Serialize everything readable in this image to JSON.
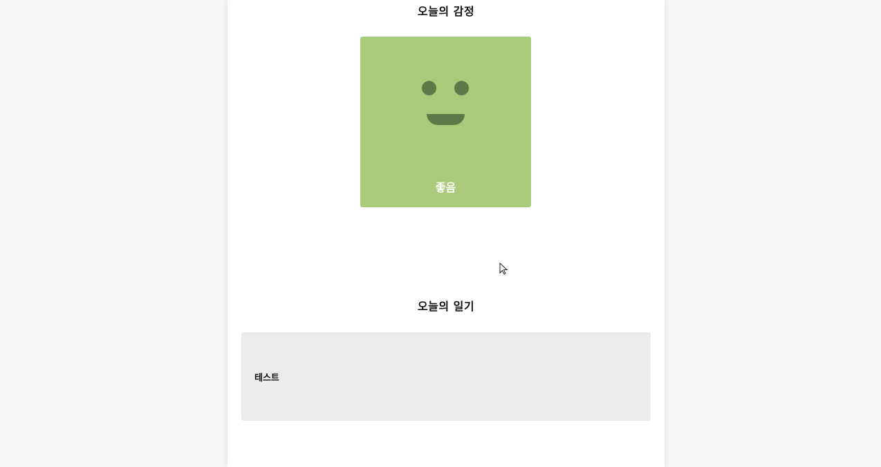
{
  "emotion_section": {
    "title": "오늘의 감정",
    "label": "좋음",
    "card_color": "#a9ca7b",
    "face_color": "#5b7a47",
    "face_icon": "smiling-face-icon"
  },
  "diary_section": {
    "title": "오늘의 일기",
    "content": "테스트",
    "box_color": "#ececec"
  },
  "cursor": {
    "icon": "mouse-pointer-icon"
  }
}
